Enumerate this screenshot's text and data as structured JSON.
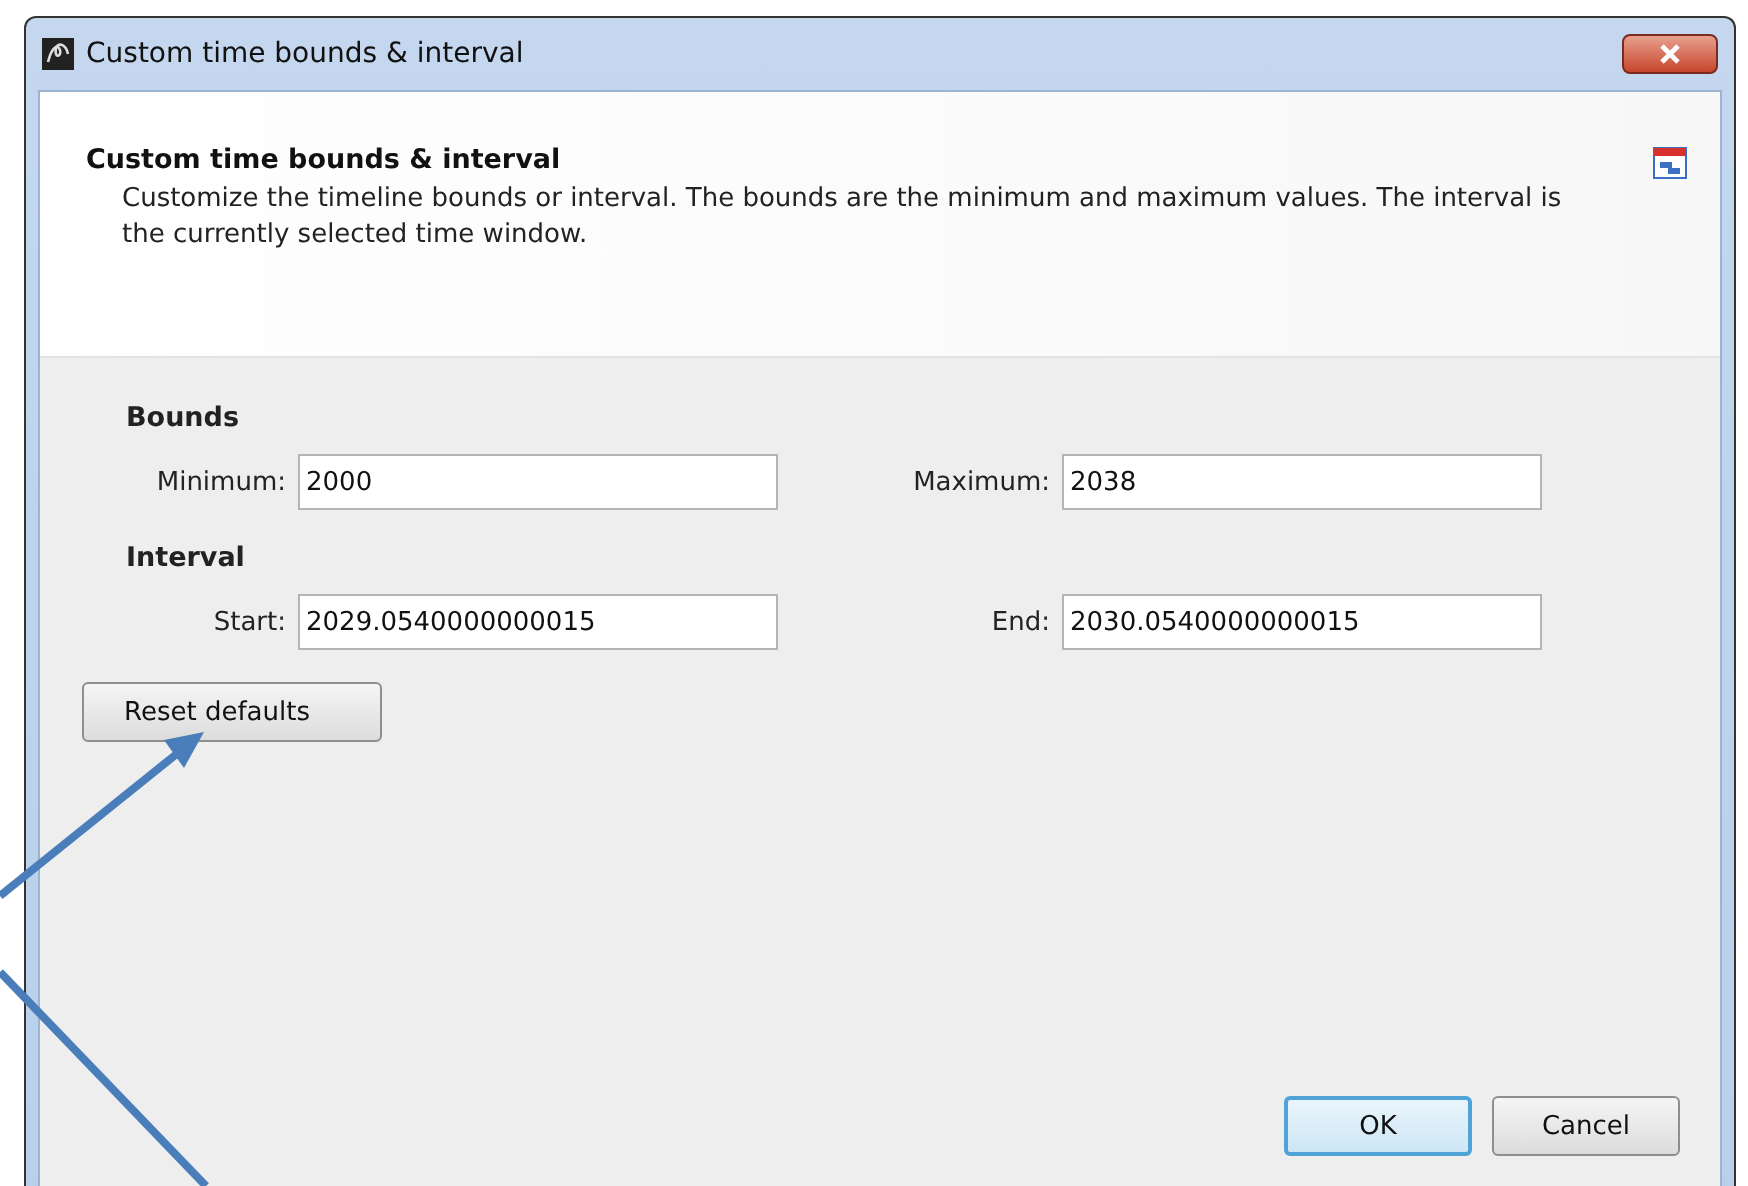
{
  "window": {
    "title": "Custom time bounds & interval"
  },
  "header": {
    "title": "Custom time bounds & interval",
    "description": "Customize the timeline bounds or interval. The bounds are the minimum and maximum values. The interval is the currently selected time window."
  },
  "sections": [
    {
      "heading": "Bounds",
      "fields": [
        {
          "label": "Minimum:",
          "value": "2000"
        },
        {
          "label": "Maximum:",
          "value": "2038"
        }
      ]
    },
    {
      "heading": "Interval",
      "fields": [
        {
          "label": "Start:",
          "value": "2029.0540000000015"
        },
        {
          "label": "End:",
          "value": "2030.0540000000015"
        }
      ]
    }
  ],
  "reset_button": "Reset defaults",
  "buttons": [
    {
      "label": "OK",
      "default": true
    },
    {
      "label": "Cancel",
      "default": false
    }
  ]
}
